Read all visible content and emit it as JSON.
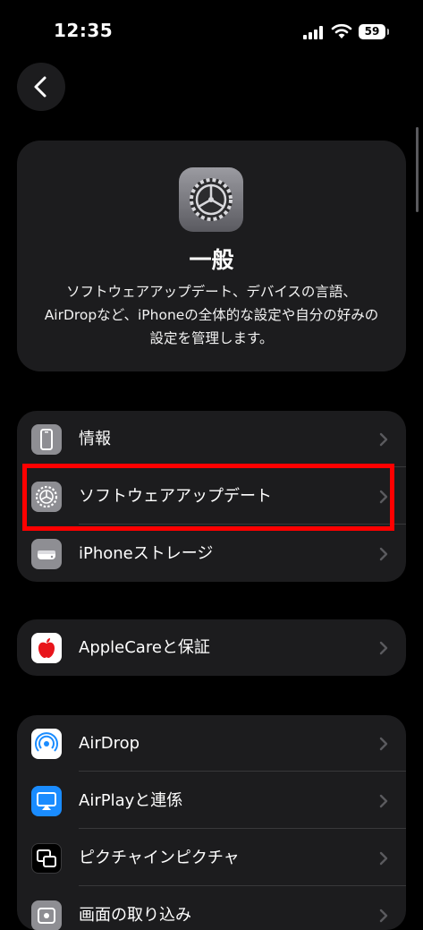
{
  "status": {
    "time": "12:35",
    "battery": "59"
  },
  "hero": {
    "title": "一般",
    "description": "ソフトウェアアップデート、デバイスの言語、AirDropなど、iPhoneの全体的な設定や自分の好みの設定を管理します。"
  },
  "group1": [
    {
      "label": "情報",
      "icon": "phone-info-icon"
    },
    {
      "label": "ソフトウェアアップデート",
      "icon": "gear-icon"
    },
    {
      "label": "iPhoneストレージ",
      "icon": "storage-icon"
    }
  ],
  "group2": [
    {
      "label": "AppleCareと保証",
      "icon": "apple-logo-icon"
    }
  ],
  "group3": [
    {
      "label": "AirDrop",
      "icon": "airdrop-icon"
    },
    {
      "label": "AirPlayと連係",
      "icon": "airplay-icon"
    },
    {
      "label": "ピクチャインピクチャ",
      "icon": "picture-in-picture-icon"
    },
    {
      "label": "画面の取り込み",
      "icon": "screen-capture-icon"
    }
  ],
  "colors": {
    "background": "#000000",
    "cell": "#1c1c1e",
    "highlight": "#ff0000",
    "airplay": "#1a8cff"
  }
}
